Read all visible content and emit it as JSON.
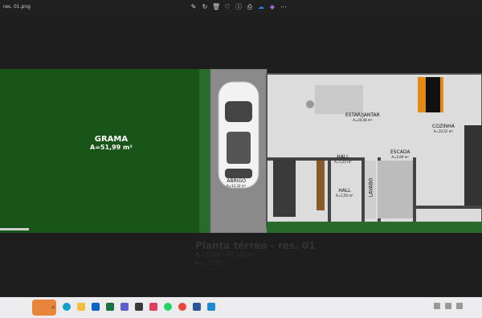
{
  "window": {
    "filename": "res. 01.png"
  },
  "toolbar": {
    "icons": [
      "edit-icon",
      "rotate-icon",
      "delete-icon",
      "favorite-icon",
      "info-icon",
      "print-icon",
      "onedrive-icon",
      "copilot-icon",
      "more-icon"
    ]
  },
  "plan": {
    "rooms": [
      {
        "name": "GRAMA",
        "area": "A=51,99 m²"
      },
      {
        "name": "ABRIGO",
        "area": "A=12,32 m²"
      },
      {
        "name": "ESTAR/JANTAR",
        "area": "A=24,46 m²"
      },
      {
        "name": "HALL",
        "area": "A=1,25 m²"
      },
      {
        "name": "LAVABO",
        "area": ""
      },
      {
        "name": "ESCADA",
        "area": "A=2,69 m²"
      },
      {
        "name": "COZINHA",
        "area": "A=10,52 m²"
      },
      {
        "name": "HALL",
        "area": "A=1,50 m²"
      }
    ],
    "title": "Planta térreo - res. 01",
    "comp": "A COMP.: 67,16 m²",
    "scale": "esc 1:50"
  },
  "taskbar": {
    "apps": [
      "weather",
      "search",
      "edge",
      "files",
      "outlook",
      "excel",
      "teams",
      "store",
      "whatsapp",
      "chrome",
      "word",
      "vscode"
    ],
    "colors": {
      "accent": "#0a64c8",
      "grass": "#1c5a1c",
      "floor": "#dcdcdc"
    }
  }
}
